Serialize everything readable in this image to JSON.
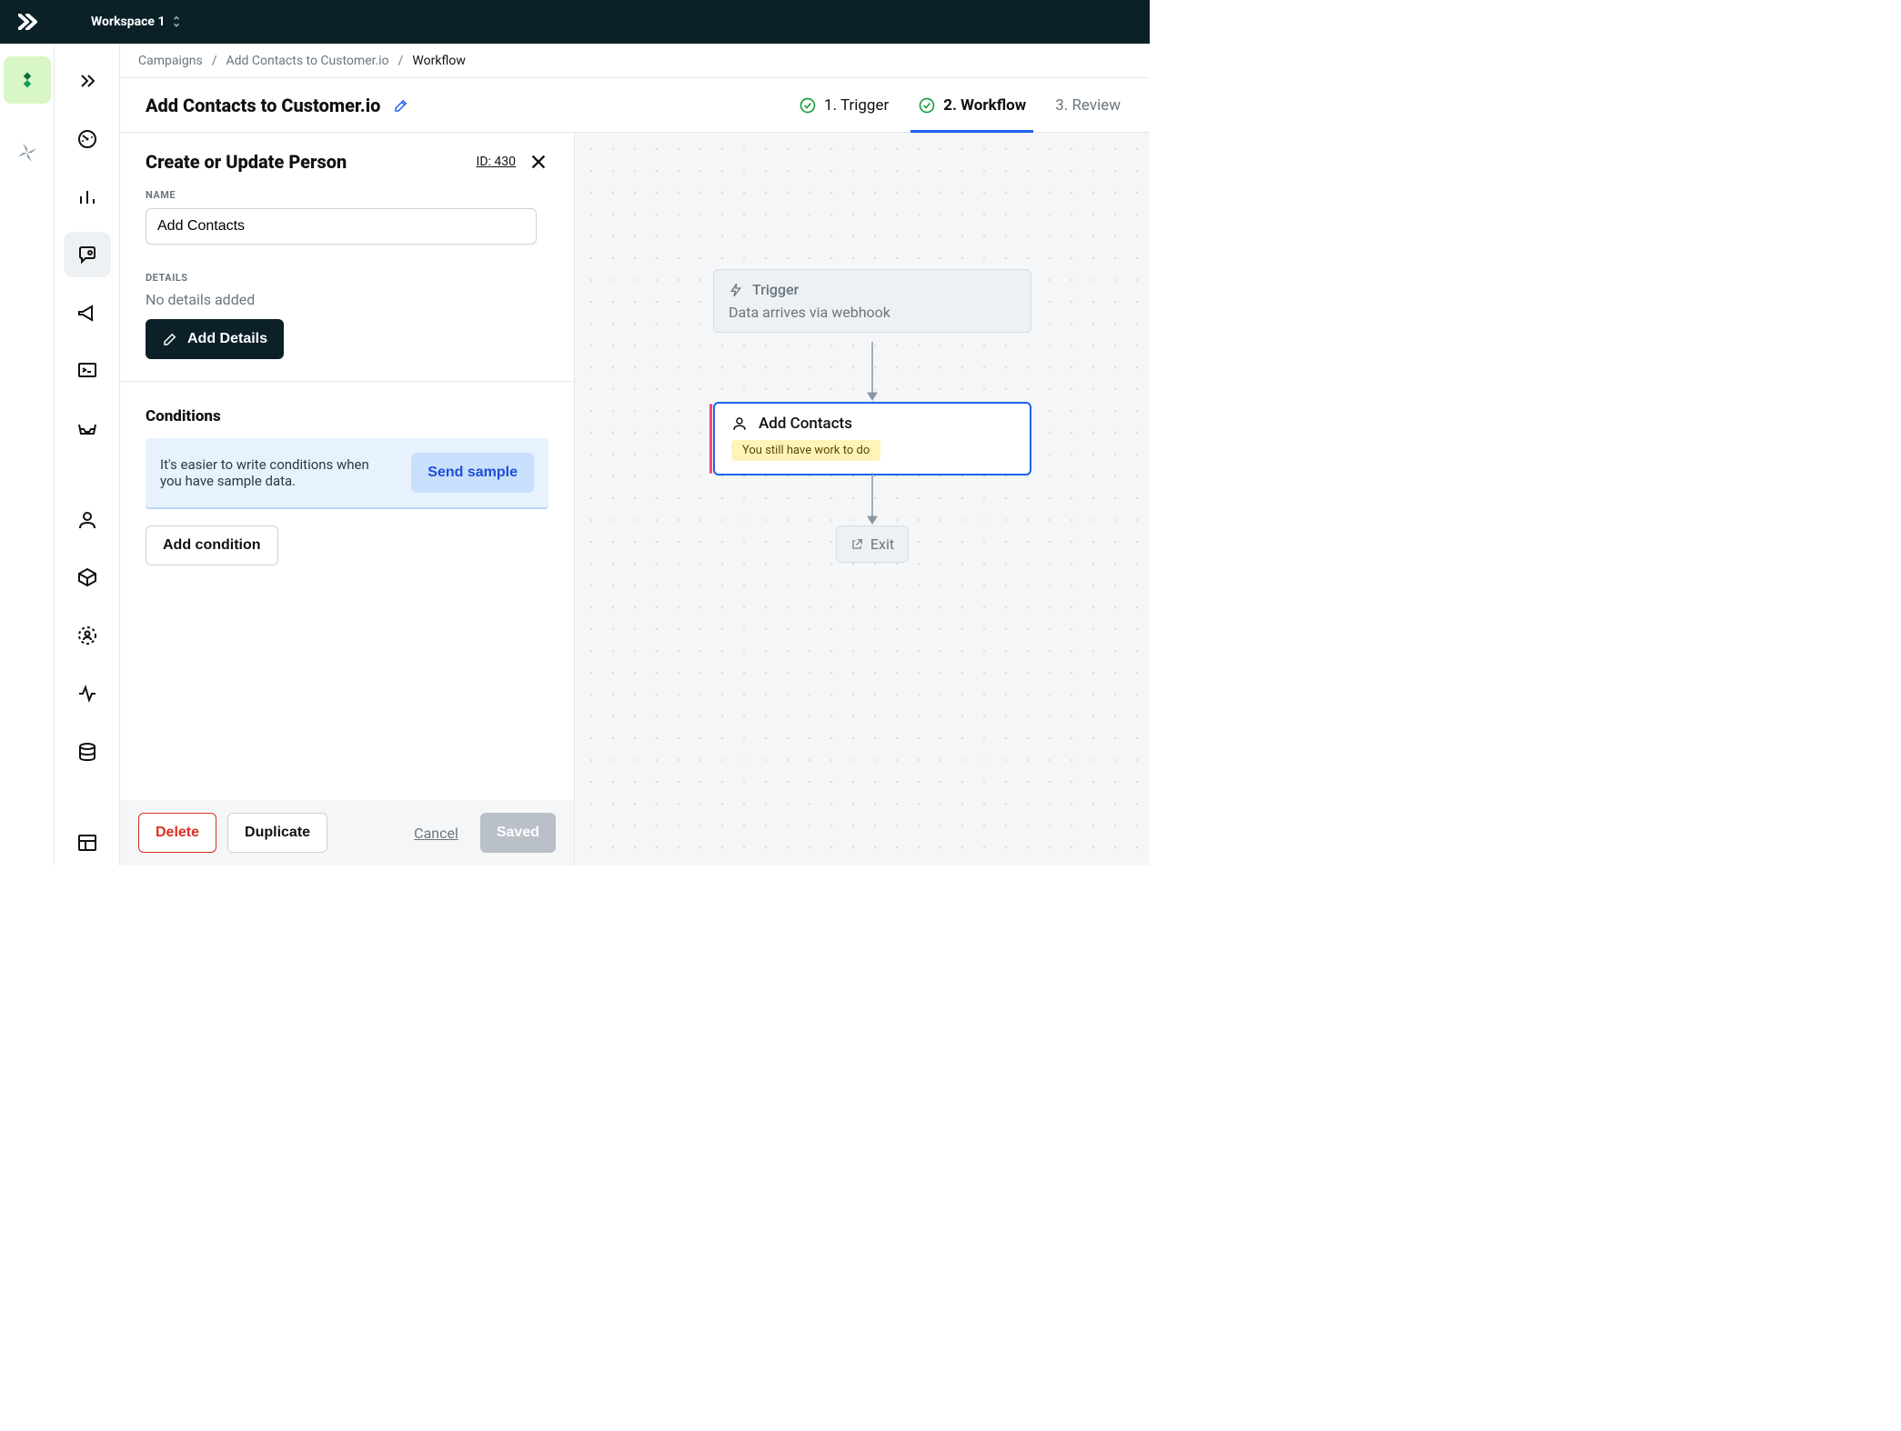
{
  "topbar": {
    "workspace_label": "Workspace 1"
  },
  "breadcrumbs": {
    "root": "Campaigns",
    "parent": "Add Contacts to Customer.io",
    "current": "Workflow"
  },
  "page_title": "Add Contacts to Customer.io",
  "steps": {
    "s1": "1. Trigger",
    "s2": "2. Workflow",
    "s3": "3. Review"
  },
  "panel": {
    "title": "Create or Update Person",
    "id_label": "ID: 430",
    "name_label": "NAME",
    "name_value": "Add Contacts",
    "details_label": "DETAILS",
    "details_empty": "No details added",
    "add_details_btn": "Add Details",
    "conditions_title": "Conditions",
    "conditions_note": "It's easier to write conditions when you have sample data.",
    "send_sample_btn": "Send sample",
    "add_condition_btn": "Add condition"
  },
  "footer": {
    "delete": "Delete",
    "duplicate": "Duplicate",
    "cancel": "Cancel",
    "saved": "Saved"
  },
  "canvas": {
    "trigger_title": "Trigger",
    "trigger_sub": "Data arrives via webhook",
    "action_title": "Add Contacts",
    "action_warn": "You still have work to do",
    "exit_label": "Exit"
  }
}
